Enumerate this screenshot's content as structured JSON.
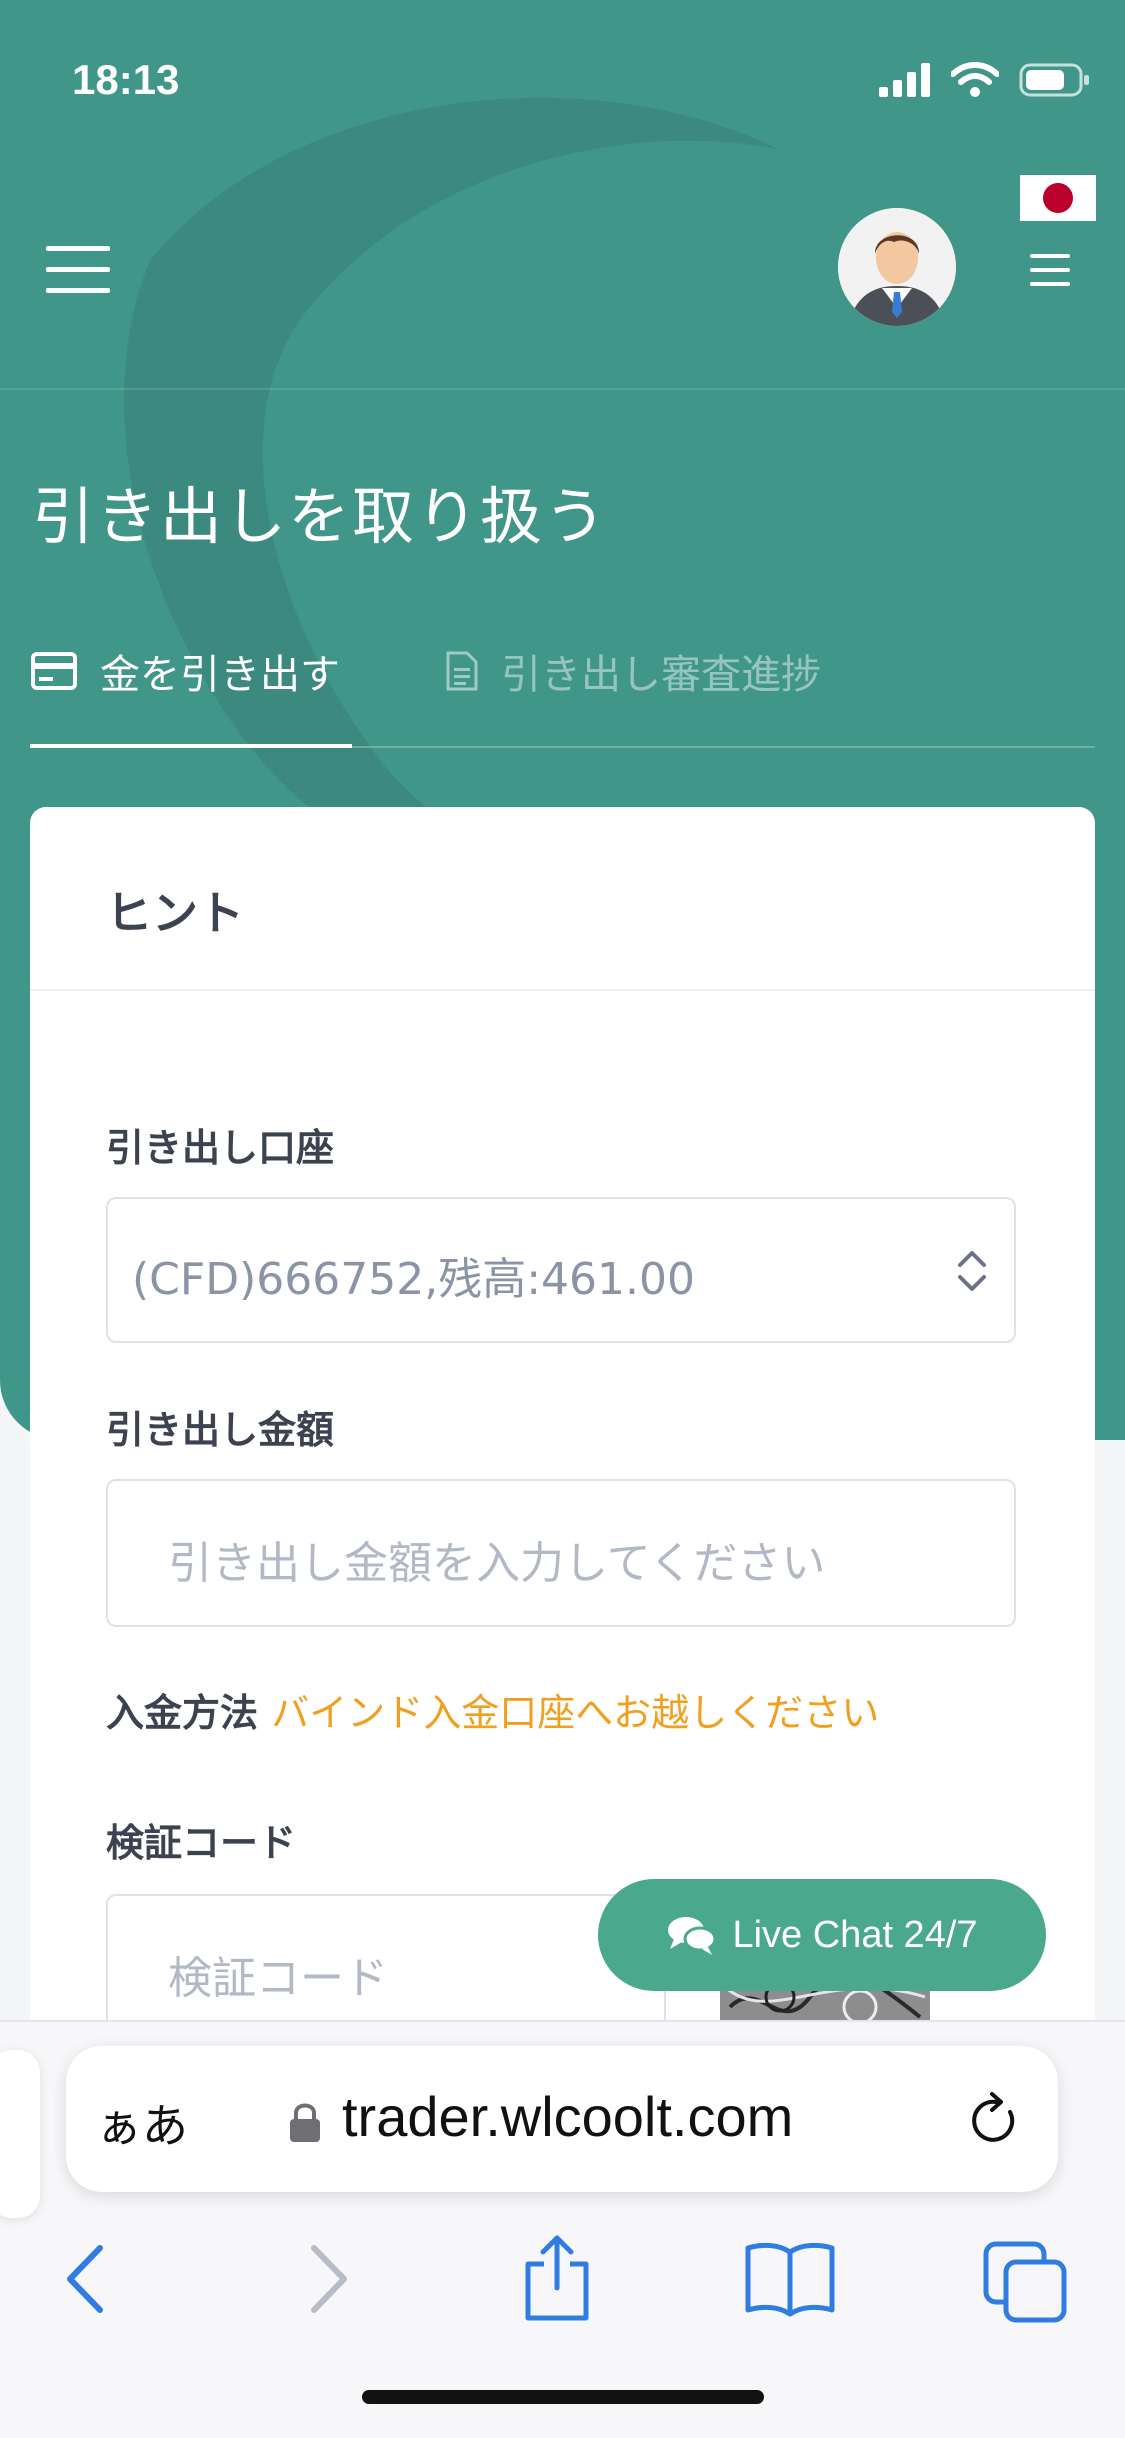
{
  "status_bar": {
    "time": "18:13"
  },
  "header": {
    "language": "Japanese"
  },
  "page": {
    "title": "引き出しを取り扱う"
  },
  "tabs": [
    {
      "label": "金を引き出す",
      "active": true
    },
    {
      "label": "引き出し審査進捗",
      "active": false
    }
  ],
  "card": {
    "title": "ヒント",
    "account_label": "引き出し口座",
    "account_value": "(CFD)666752,残高:461.00",
    "amount_label": "引き出し金額",
    "amount_placeholder": "引き出し金額を入力してください",
    "deposit_method_label": "入金方法",
    "deposit_method_link": "バインド入金口座へお越しください",
    "code_label": "検証コード",
    "code_placeholder": "検証コード"
  },
  "chat": {
    "label": "Live Chat 24/7"
  },
  "browser": {
    "aa_label": "ぁあ",
    "url": "trader.wlcoolt.com"
  },
  "colors": {
    "header_bg": "#41968a",
    "link_orange": "#f0a020",
    "chat_bg": "#4aa88d",
    "ios_blue": "#2f7de1"
  }
}
